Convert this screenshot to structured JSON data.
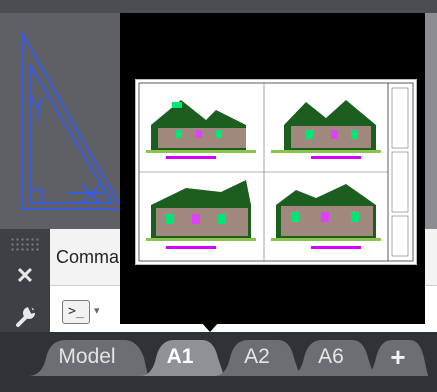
{
  "command_line": {
    "history_text": "Comma",
    "prompt_symbol": ">_",
    "dropdown_symbol": "▾"
  },
  "panel_controls": {
    "close_symbol": "✕"
  },
  "tabs": [
    {
      "label": "Model"
    },
    {
      "label": "A1"
    },
    {
      "label": "A2"
    },
    {
      "label": "A6"
    }
  ],
  "add_tab_symbol": "+",
  "colors": {
    "drawing_background": "#5e6066",
    "drawing_lines": "#2f5bff",
    "preview_background": "#000000",
    "tab_active_text": "#ffffff",
    "tab_bar": "#2f3236"
  }
}
